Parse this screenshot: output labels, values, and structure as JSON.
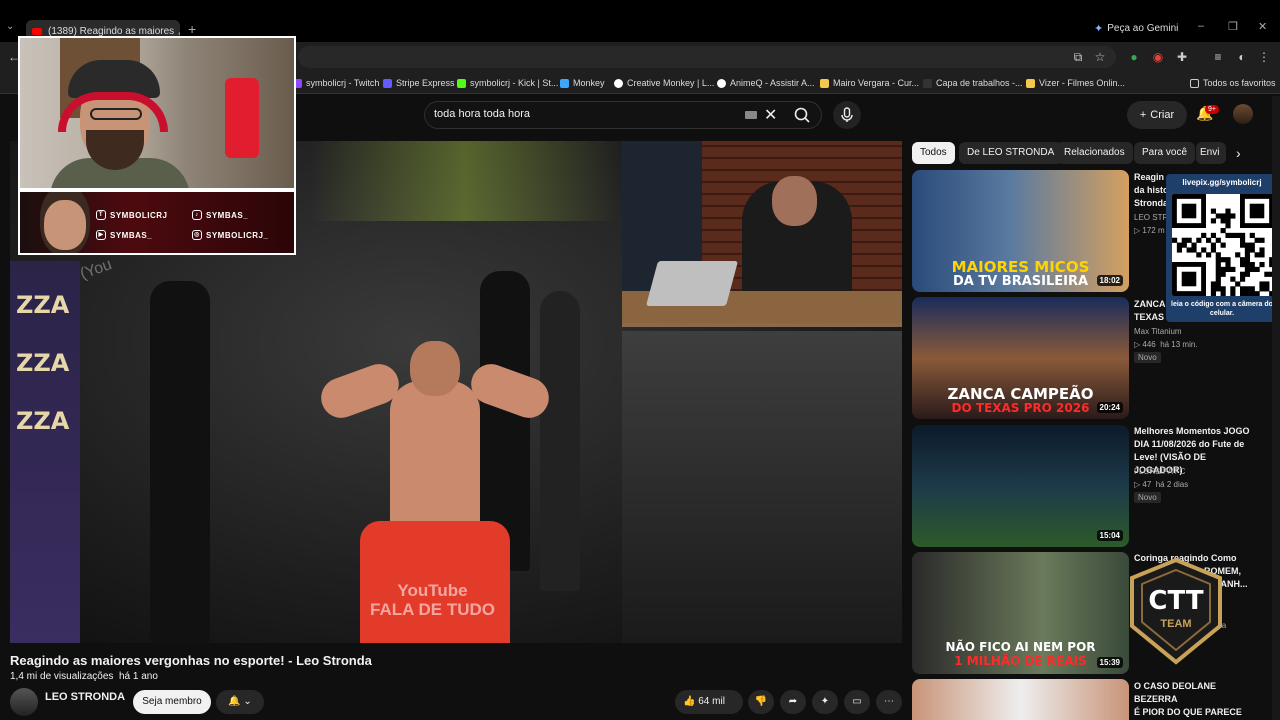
{
  "browser": {
    "tab_title": "(1389) Reagindo as maiores",
    "gemini_label": "Peça ao Gemini",
    "bookmarks": [
      {
        "label": "symbolicrj - Twitch",
        "color": "#9146ff"
      },
      {
        "label": "Stripe Express",
        "color": "#635bff"
      },
      {
        "label": "symbolicrj - Kick | St...",
        "color": "#53fc18"
      },
      {
        "label": "Monkey",
        "color": "#3ea6ff"
      },
      {
        "label": "Creative Monkey | L...",
        "color": "#ffffff"
      },
      {
        "label": "AnimeQ - Assistir A...",
        "color": "#ffffff"
      },
      {
        "label": "Mairo Vergara - Cur...",
        "color": "#f2c94c"
      },
      {
        "label": "Capa de trabalhos -...",
        "color": "#333333"
      },
      {
        "label": "Vizer - Filmes Onlin...",
        "color": "#f2c94c"
      }
    ],
    "all_bookmarks": "Todos os favoritos"
  },
  "youtube": {
    "search_value": "toda hora toda hora",
    "create_label": "Criar",
    "notification_count": "9+"
  },
  "video": {
    "watermark_line1": "YouTube",
    "watermark_line2": "FALA DE TUDO",
    "title": "Reagindo as maiores vergonhas no esporte! - Leo Stronda",
    "views": "1,4 mi de visualizações",
    "age": "há 1 ano",
    "channel": "LEO STRONDA",
    "join_label": "Seja membro",
    "likes": "64 mil"
  },
  "overlay": {
    "socials": [
      {
        "icon": "twitch-icon",
        "label": "SYMBOLICRJ"
      },
      {
        "icon": "tiktok-icon",
        "label": "SYMBAS_"
      },
      {
        "icon": "youtube-icon",
        "label": "SYMBAS_"
      },
      {
        "icon": "instagram-icon",
        "label": "SYMBOLICRJ_"
      }
    ],
    "qr_url": "livepix.gg/symbolicrj",
    "qr_caption": "leia o código com a câmera do celular."
  },
  "chips": [
    "Todos",
    "De LEO STRONDA",
    "Relacionados",
    "Para você",
    "Envi"
  ],
  "recommendations": [
    {
      "title_l1": "Reagin",
      "title_l2": "da histo",
      "title_l3": "Stronda",
      "channel": "LEO STR",
      "views": "172 m",
      "age": "",
      "duration": "18:02",
      "thumb_l1": "MAIORES MICOS",
      "thumb_l2": "DA TV BRASILEIRA",
      "new": ""
    },
    {
      "title_l1": "ZANCA",
      "title_l2": "TEXAS",
      "title_l3": "",
      "channel": "Max Titanium",
      "views": "446",
      "age": "há 13 min.",
      "duration": "20:24",
      "thumb_l1": "ZANCA CAMPEÃO",
      "thumb_l2": "DO TEXAS PRO 2026",
      "new": "Novo"
    },
    {
      "title_l1": "Melhores Momentos JOGO",
      "title_l2": "DIA 11/08/2026 do Fute de",
      "title_l3": "Leve! (VISÃO DE JOGADOR)",
      "channel": "FLOR&IPA FC",
      "views": "47",
      "age": "há 2 dias",
      "duration": "15:04",
      "thumb_l1": "",
      "thumb_l2": "",
      "new": "Novo"
    },
    {
      "title_l1": "Coringa reagindo Como",
      "title_l2": "ROMEM,",
      "title_l3": "M BANH...",
      "channel": "ica",
      "views": "",
      "age": "",
      "duration": "15:39",
      "thumb_l1": "NÃO FICO AI NEM POR",
      "thumb_l2": "1 MILHÃO DE REAIS",
      "new": ""
    },
    {
      "title_l1": "O CASO DEOLANE BEZERRA",
      "title_l2": "É PIOR DO QUE PARECE",
      "title_l3": "",
      "channel": "",
      "views": "",
      "age": "",
      "duration": "",
      "thumb_l1": "",
      "thumb_l2": "",
      "new": ""
    }
  ],
  "ctt_badge": {
    "line1": "CTT",
    "line2": "TEAM"
  }
}
